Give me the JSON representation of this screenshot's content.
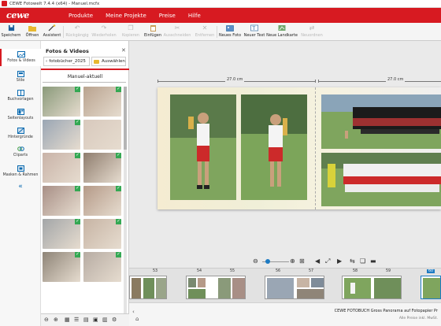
{
  "window": {
    "title": "CEWE Fotowelt 7.4.4 (x64) - Manuel.mcfx"
  },
  "menu": {
    "logo": "cewe",
    "items": [
      "Produkte",
      "Meine Projekte",
      "Preise",
      "Hilfe"
    ]
  },
  "toolbar": {
    "items": [
      {
        "label": "Speichern",
        "icon": "save-icon",
        "enabled": true
      },
      {
        "label": "Öffnen",
        "icon": "folder-open-icon",
        "enabled": true
      },
      {
        "label": "Assistent",
        "icon": "wizard-icon",
        "enabled": true
      },
      {
        "label": "Rückgängig",
        "icon": "undo-icon",
        "enabled": false
      },
      {
        "label": "Wiederholen",
        "icon": "redo-icon",
        "enabled": false
      },
      {
        "label": "Kopieren",
        "icon": "copy-icon",
        "enabled": false
      },
      {
        "label": "Einfügen",
        "icon": "paste-icon",
        "enabled": true
      },
      {
        "label": "Ausschneiden",
        "icon": "cut-icon",
        "enabled": false
      },
      {
        "label": "Entfernen",
        "icon": "delete-icon",
        "enabled": false
      },
      {
        "label": "Neues Foto",
        "icon": "new-photo-icon",
        "enabled": true
      },
      {
        "label": "Neuer Text",
        "icon": "new-text-icon",
        "enabled": true
      },
      {
        "label": "Neue Landkarte",
        "icon": "new-map-icon",
        "enabled": true
      },
      {
        "label": "Neuordnen",
        "icon": "rearrange-icon",
        "enabled": false
      }
    ]
  },
  "sidebar": {
    "items": [
      {
        "label": "Fotos & Videos",
        "icon": "photos-icon",
        "active": true
      },
      {
        "label": "Stile",
        "icon": "styles-icon",
        "active": false
      },
      {
        "label": "Buchvorlagen",
        "icon": "book-templates-icon",
        "active": false
      },
      {
        "label": "Seitenlayouts",
        "icon": "page-layouts-icon",
        "active": false
      },
      {
        "label": "Hintergründe",
        "icon": "backgrounds-icon",
        "active": false
      },
      {
        "label": "Cliparts",
        "icon": "cliparts-icon",
        "active": false
      },
      {
        "label": "Masken & Rahmen",
        "icon": "masks-frames-icon",
        "active": false
      }
    ],
    "collapse_glyph": "«"
  },
  "panel": {
    "title": "Fotos & Videos",
    "back_label": "fotobücher_2025",
    "select_label": "Auswählen",
    "folder_name": "Manuel-aktuell",
    "thumbnails": [
      {
        "color": "#8a9a7a",
        "checked": true
      },
      {
        "color": "#b9a38f",
        "checked": true
      },
      {
        "color": "#9aa6b4",
        "checked": true
      },
      {
        "color": "#d8c9bd",
        "checked": false
      },
      {
        "color": "#c9b3a8",
        "checked": true
      },
      {
        "color": "#8f7d6e",
        "checked": true
      },
      {
        "color": "#a88f86",
        "checked": true
      },
      {
        "color": "#b59a88",
        "checked": true
      },
      {
        "color": "#a3a6a8",
        "checked": true
      },
      {
        "color": "#c7b4a4",
        "checked": true
      },
      {
        "color": "#8f8578",
        "checked": true
      },
      {
        "color": "#b7aca3",
        "checked": true
      },
      {
        "color": "#7f8c99",
        "checked": false
      },
      {
        "color": "#a09488",
        "checked": true
      }
    ]
  },
  "canvas": {
    "ruler_left": "27.0 cm",
    "ruler_right": "27.0 cm"
  },
  "filmstrip": {
    "pages": [
      "53",
      "54",
      "55",
      "56",
      "57",
      "58",
      "59",
      "60"
    ],
    "active_page": "60"
  },
  "status": {
    "product": "CEWE FOTOBUCH Gross Panorama auf Fotopapier Pr",
    "price": "Alle Preise inkl. MwSt."
  },
  "colors": {
    "brand_red": "#d71a21",
    "check_green": "#34a853",
    "accent_blue": "#1d7bc3"
  }
}
